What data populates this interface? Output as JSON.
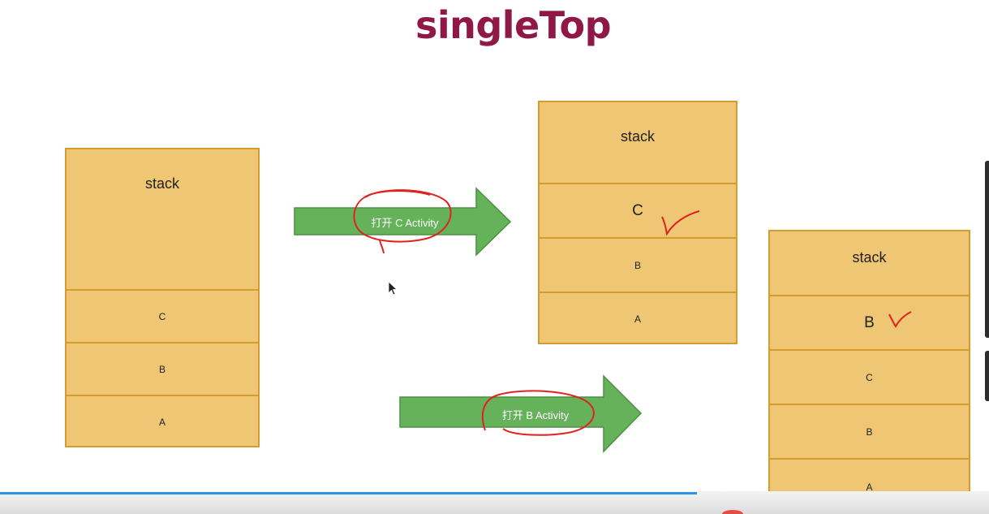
{
  "title": "singleTop",
  "stacks": [
    {
      "header": "stack",
      "cells": [
        "C",
        "B",
        "A"
      ]
    },
    {
      "header": "stack",
      "cells": [
        "C",
        "B",
        "A"
      ]
    },
    {
      "header": "stack",
      "cells": [
        "B",
        "C",
        "B",
        "A"
      ]
    }
  ],
  "arrows": [
    {
      "label": "打开 C Activity"
    },
    {
      "label": "打开 B Activity"
    }
  ],
  "progress": {
    "fraction": 0.705
  },
  "colors": {
    "title": "#8f1846",
    "stack_fill": "#efc673",
    "stack_border": "#d49b2e",
    "arrow_fill": "#66b25a",
    "annotation": "#e0221f",
    "progress": "#2a94e6"
  }
}
